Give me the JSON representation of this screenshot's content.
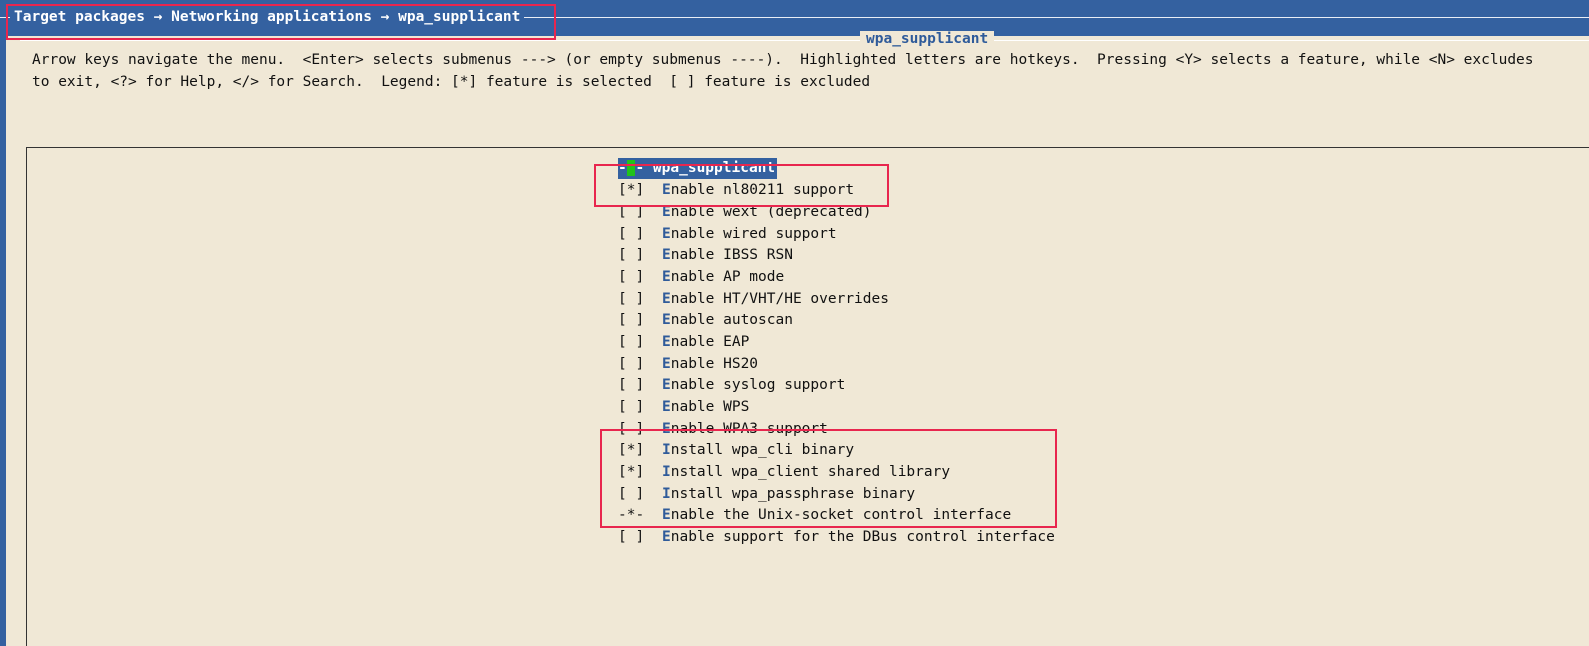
{
  "window": {
    "breadcrumb": "Target packages → Networking applications → wpa_supplicant",
    "dialog_title": "wpa_supplicant"
  },
  "help": {
    "line1": "Arrow keys navigate the menu.  <Enter> selects submenus ---> (or empty submenus ----).  Highlighted letters are hotkeys.  Pressing <Y> selects a feature, while <N> excludes",
    "line2": "to exit, <?> for Help, </> for Search.  Legend: [*] feature is selected  [ ] feature is excluded"
  },
  "menu": {
    "selected_item": {
      "prefix": "-",
      "cursor": "*",
      "suffix": "- wpa_supplicant"
    },
    "items": [
      {
        "mark": "[*]",
        "hotkey": "E",
        "rest": "nable nl80211 support"
      },
      {
        "mark": "[ ]",
        "hotkey": "E",
        "rest": "nable wext (deprecated)"
      },
      {
        "mark": "[ ]",
        "hotkey": "E",
        "rest": "nable wired support"
      },
      {
        "mark": "[ ]",
        "hotkey": "E",
        "rest": "nable IBSS RSN"
      },
      {
        "mark": "[ ]",
        "hotkey": "E",
        "rest": "nable AP mode"
      },
      {
        "mark": "[ ]",
        "hotkey": "E",
        "rest": "nable HT/VHT/HE overrides"
      },
      {
        "mark": "[ ]",
        "hotkey": "E",
        "rest": "nable autoscan"
      },
      {
        "mark": "[ ]",
        "hotkey": "E",
        "rest": "nable EAP"
      },
      {
        "mark": "[ ]",
        "hotkey": "E",
        "rest": "nable HS20"
      },
      {
        "mark": "[ ]",
        "hotkey": "E",
        "rest": "nable syslog support"
      },
      {
        "mark": "[ ]",
        "hotkey": "E",
        "rest": "nable WPS"
      },
      {
        "mark": "[ ]",
        "hotkey": "E",
        "rest": "nable WPA3 support"
      },
      {
        "mark": "[*]",
        "hotkey": "I",
        "rest": "nstall wpa_cli binary"
      },
      {
        "mark": "[*]",
        "hotkey": "I",
        "rest": "nstall wpa_client shared library"
      },
      {
        "mark": "[ ]",
        "hotkey": "I",
        "rest": "nstall wpa_passphrase binary"
      },
      {
        "mark": "-*-",
        "hotkey": "E",
        "rest": "nable the Unix-socket control interface"
      },
      {
        "mark": "[ ]",
        "hotkey": "E",
        "rest": "nable support for the DBus control interface"
      }
    ]
  },
  "colors": {
    "background": "#f0e8d6",
    "title_bar": "#3461a0",
    "hotkey": "#2f5b9a",
    "annotation_box": "#e8264e",
    "cursor": "#21c21b"
  }
}
